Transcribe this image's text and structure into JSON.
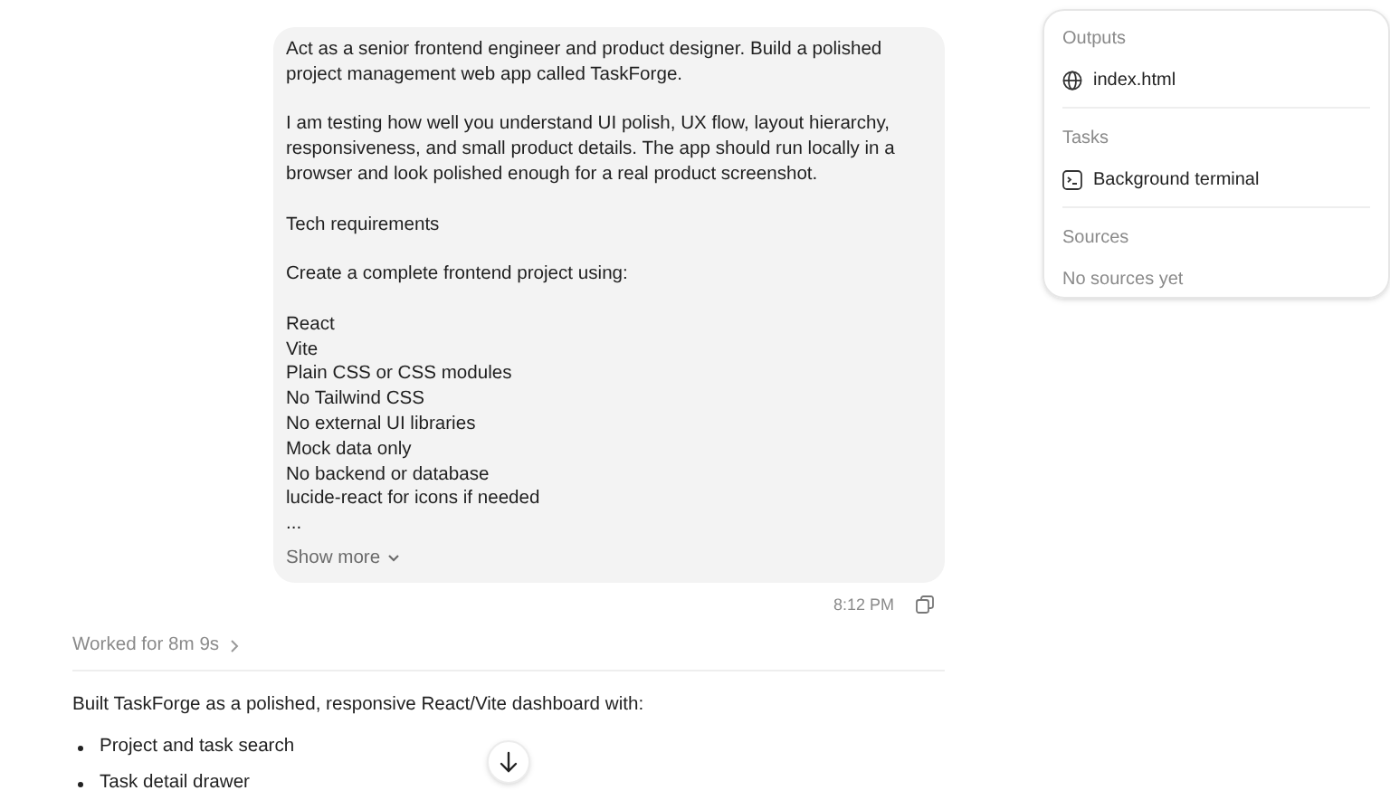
{
  "user_message": {
    "blocks": [
      {
        "kind": "paragraph",
        "text": "Act as a senior frontend engineer and product designer. Build a polished project management web app called TaskForge."
      },
      {
        "kind": "paragraph",
        "text": "I am testing how well you understand UI polish, UX flow, layout hierarchy, responsiveness, and small product details. The app should run locally in a browser and look polished enough for a real product screenshot."
      },
      {
        "kind": "paragraph",
        "text": "Tech requirements"
      },
      {
        "kind": "paragraph",
        "text": "Create a complete frontend project using:"
      },
      {
        "kind": "lines",
        "items": [
          "React",
          "Vite",
          "Plain CSS or CSS modules",
          "No Tailwind CSS",
          "No external UI libraries",
          "Mock data only",
          "No backend or database",
          "lucide-react for icons if needed",
          "..."
        ]
      }
    ],
    "show_more": "Show more",
    "time": "8:12 PM"
  },
  "worked": {
    "label": "Worked for 8m 9s"
  },
  "response": {
    "intro": "Built TaskForge as a polished, responsive React/Vite dashboard with:",
    "bullets": [
      "Project and task search",
      "Task detail drawer"
    ]
  },
  "side_panel": {
    "sections": [
      {
        "heading": "Outputs",
        "items": [
          {
            "kind": "web",
            "label": "index.html"
          }
        ]
      },
      {
        "heading": "Tasks",
        "items": [
          {
            "kind": "terminal",
            "label": "Background terminal"
          }
        ]
      },
      {
        "heading": "Sources",
        "items": [
          {
            "kind": "empty",
            "label": "No sources yet"
          }
        ]
      }
    ]
  }
}
